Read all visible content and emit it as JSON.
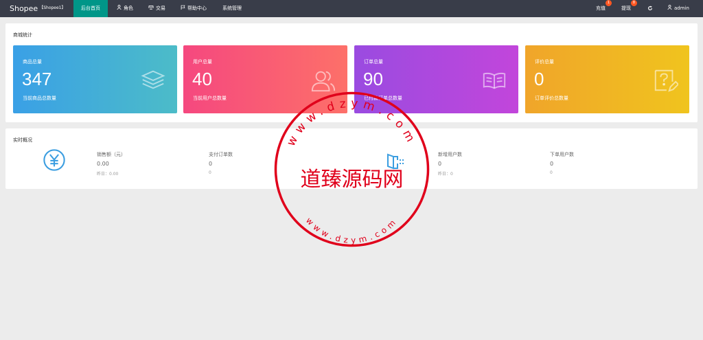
{
  "brand": {
    "name": "Shopee",
    "sub": "【Shopee1】"
  },
  "nav": [
    {
      "label": "后台首页",
      "icon": "",
      "active": true
    },
    {
      "label": "角色",
      "icon": "user-icon"
    },
    {
      "label": "交易",
      "icon": "scale-icon"
    },
    {
      "label": "帮助中心",
      "icon": "flag-icon"
    },
    {
      "label": "系统管理",
      "icon": ""
    }
  ],
  "topright": {
    "recharge": {
      "label": "充值",
      "badge": "1"
    },
    "withdraw": {
      "label": "提现",
      "badge": "8"
    },
    "refresh_icon": "refresh-icon",
    "admin": "admin"
  },
  "stats": {
    "title": "商城统计",
    "cards": [
      {
        "label": "商品总量",
        "value": "347",
        "desc": "当前商品总数量",
        "icon": "layers-icon",
        "gradient": [
          "#3aa0e6",
          "#4cbcc8"
        ]
      },
      {
        "label": "用户总量",
        "value": "40",
        "desc": "当前用户总数量",
        "icon": "users-icon",
        "gradient": [
          "#f5487f",
          "#fd7069"
        ]
      },
      {
        "label": "订单总量",
        "value": "90",
        "desc": "已付款订单总数量",
        "icon": "book-icon",
        "gradient": [
          "#9a4be0",
          "#c246db"
        ]
      },
      {
        "label": "评价总量",
        "value": "0",
        "desc": "订单评价总数量",
        "icon": "comment-edit-icon",
        "gradient": [
          "#f0a52a",
          "#f0c41e"
        ]
      }
    ]
  },
  "realtime": {
    "title": "实时概况",
    "sales": {
      "label": "销售额（元）",
      "value": "0.00",
      "yesterday": "昨日：0.00"
    },
    "paid_orders": {
      "label": "支付订单数",
      "value": "0",
      "yesterday": "0"
    },
    "new_users": {
      "label": "新增用户数",
      "value": "0",
      "yesterday": "昨日：0"
    },
    "order_users": {
      "label": "下单用户数",
      "value": "0",
      "yesterday": "0"
    }
  },
  "watermark": {
    "text": "道臻源码网",
    "url_top": "www.dzym.com",
    "url_bottom": "www.dzym.com",
    "color": "#e0001b"
  }
}
